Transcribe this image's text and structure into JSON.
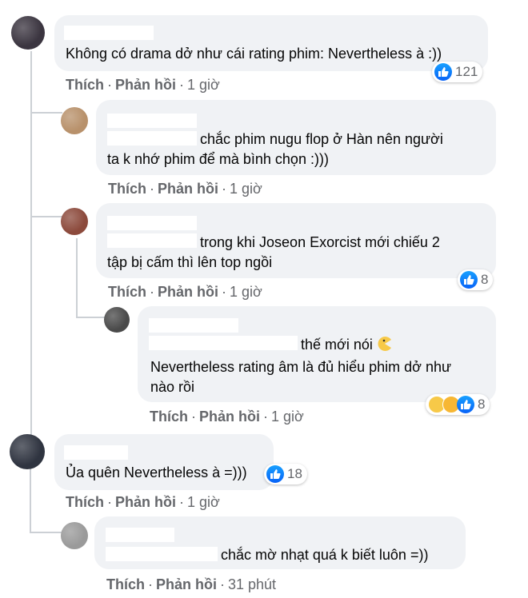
{
  "comments": [
    {
      "text": "Không có drama dở như cái rating phim: Nevertheless à :))",
      "like": "Thích",
      "reply": "Phản hồi",
      "time": "1 giờ",
      "reactions": "121"
    },
    {
      "text_line1": "chắc phim nugu flop ở Hàn nên người",
      "text_line2": "ta k nhớ phim để mà bình chọn :)))",
      "like": "Thích",
      "reply": "Phản hồi",
      "time": "1 giờ"
    },
    {
      "text_line1": "trong khi Joseon Exorcist mới chiếu 2",
      "text_line2": "tập bị cấm thì lên top ngồi",
      "like": "Thích",
      "reply": "Phản hồi",
      "time": "1 giờ",
      "reactions": "8"
    },
    {
      "text_line1": "thế mới nói",
      "text_line2": "Nevertheless rating âm là đủ hiểu phim dở như",
      "text_line3": "nào rồi",
      "like": "Thích",
      "reply": "Phản hồi",
      "time": "1 giờ",
      "reactions": "8"
    },
    {
      "text": "Ủa quên Nevertheless à =)))",
      "like": "Thích",
      "reply": "Phản hồi",
      "time": "1 giờ",
      "reactions": "18"
    },
    {
      "text": "chắc mờ nhạt quá k biết luôn =))",
      "like": "Thích",
      "reply": "Phản hồi",
      "time": "31 phút"
    }
  ],
  "colors": {
    "bubble": "#f0f2f5",
    "meta": "#65676b",
    "like_blue": "#1877f2"
  },
  "icons": {
    "like": "like-icon",
    "haha": "haha-icon",
    "sad": "sad-icon",
    "emoji": "pacman-emoji-icon"
  }
}
